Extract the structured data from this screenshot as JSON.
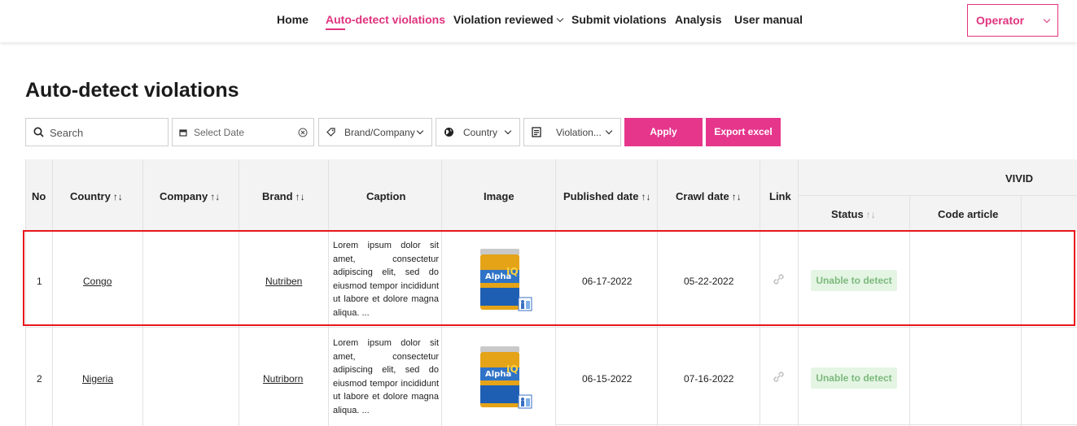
{
  "nav": {
    "items": [
      "Home",
      "Auto-detect violations",
      "Violation reviewed",
      "Submit violations",
      "Analysis",
      "User manual"
    ],
    "operator": "Operator"
  },
  "page": {
    "title": "Auto-detect violations"
  },
  "filters": {
    "search_placeholder": "Search",
    "date_placeholder": "Select Date",
    "brand_label": "Brand/Company",
    "country_label": "Country",
    "violation_label": "Violation...",
    "apply_label": "Apply",
    "export_label": "Export excel"
  },
  "table": {
    "headers": {
      "no": "No",
      "country": "Country",
      "company": "Company",
      "brand": "Brand",
      "caption": "Caption",
      "image": "Image",
      "published": "Published date",
      "crawl": "Crawl date",
      "link": "Link",
      "group": "VIVID",
      "status": "Status",
      "code": "Code article"
    },
    "sort_glyph": "↑↓",
    "rows": [
      {
        "no": "1",
        "country": "Congo",
        "company": "",
        "brand": "Nutriben",
        "caption": "Lorem ipsum dolor sit amet, consectetur adipiscing elit, sed do eiusmod tempor incididunt ut labore et dolore magna aliqua. ...",
        "published": "06-17-2022",
        "crawl": "05-22-2022",
        "status": "Unable to detect",
        "code": ""
      },
      {
        "no": "2",
        "country": "Nigeria",
        "company": "",
        "brand": "Nutriborn",
        "caption": "Lorem ipsum dolor sit amet, consectetur adipiscing elit, sed do eiusmod tempor incididunt ut labore et dolore magna aliqua. ...",
        "published": "06-15-2022",
        "crawl": "07-16-2022",
        "status": "Unable to detect",
        "code": ""
      }
    ]
  },
  "colors": {
    "accent": "#e0337e",
    "button": "#e5368c",
    "badge_bg": "#e4f5e4",
    "badge_text": "#7cb97c",
    "highlight": "#e8161b"
  },
  "icons": [
    "search-icon",
    "calendar-icon",
    "clear-icon",
    "tag-icon",
    "globe-icon",
    "list-icon",
    "chevron-down-icon",
    "link-icon"
  ]
}
